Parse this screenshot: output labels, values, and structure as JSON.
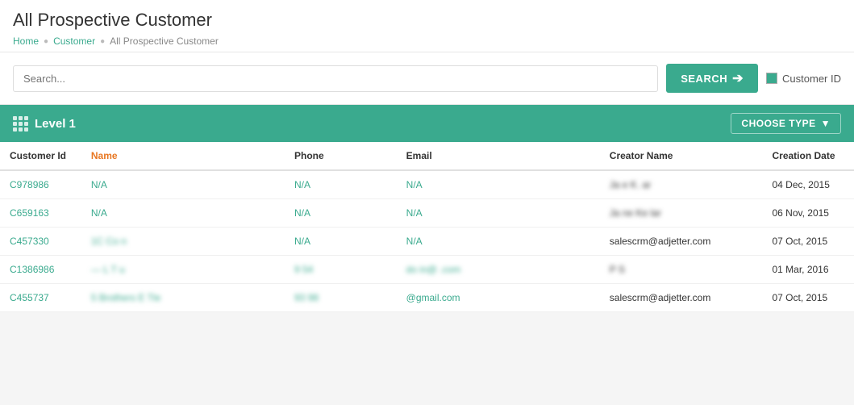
{
  "page": {
    "title": "All Prospective Customer",
    "breadcrumb": {
      "home": "Home",
      "parent": "Customer",
      "current": "All Prospective Customer"
    }
  },
  "search": {
    "placeholder": "Search...",
    "button_label": "SEARCH",
    "customer_id_label": "Customer ID"
  },
  "table": {
    "level_label": "Level 1",
    "choose_type_label": "CHOOSE TYPE",
    "columns": {
      "customer_id": "Customer Id",
      "name": "Name",
      "phone": "Phone",
      "email": "Email",
      "creator_name": "Creator Name",
      "creation_date": "Creation Date"
    },
    "rows": [
      {
        "id": "C978986",
        "name": "N/A",
        "phone": "N/A",
        "email": "N/A",
        "creator": "Ja  e K.  ar",
        "creator_blurred": true,
        "date": "04 Dec, 2015"
      },
      {
        "id": "C659163",
        "name": "N/A",
        "phone": "N/A",
        "email": "N/A",
        "creator": "Ja  ne Ke  lar",
        "creator_blurred": true,
        "date": "06 Nov, 2015"
      },
      {
        "id": "C457330",
        "name": "1C  Co      n",
        "name_blurred": true,
        "phone": "N/A",
        "email": "N/A",
        "creator": "salescrm@adjetter.com",
        "date": "07 Oct, 2015"
      },
      {
        "id": "C1386986",
        "name": "— L T        u",
        "name_blurred": true,
        "phone": "9      54",
        "phone_blurred": true,
        "email": "do  in@       .com",
        "email_blurred": true,
        "creator": "P    S",
        "creator_blurred": true,
        "date": "01 Mar, 2016"
      },
      {
        "id": "C455737",
        "name": "5 Brothers E   Tle",
        "name_blurred": true,
        "phone": "93     98",
        "phone_blurred": true,
        "email": "    @gmail.com",
        "email_partial": true,
        "creator": "salescrm@adjetter.com",
        "date": "07 Oct, 2015"
      }
    ]
  }
}
